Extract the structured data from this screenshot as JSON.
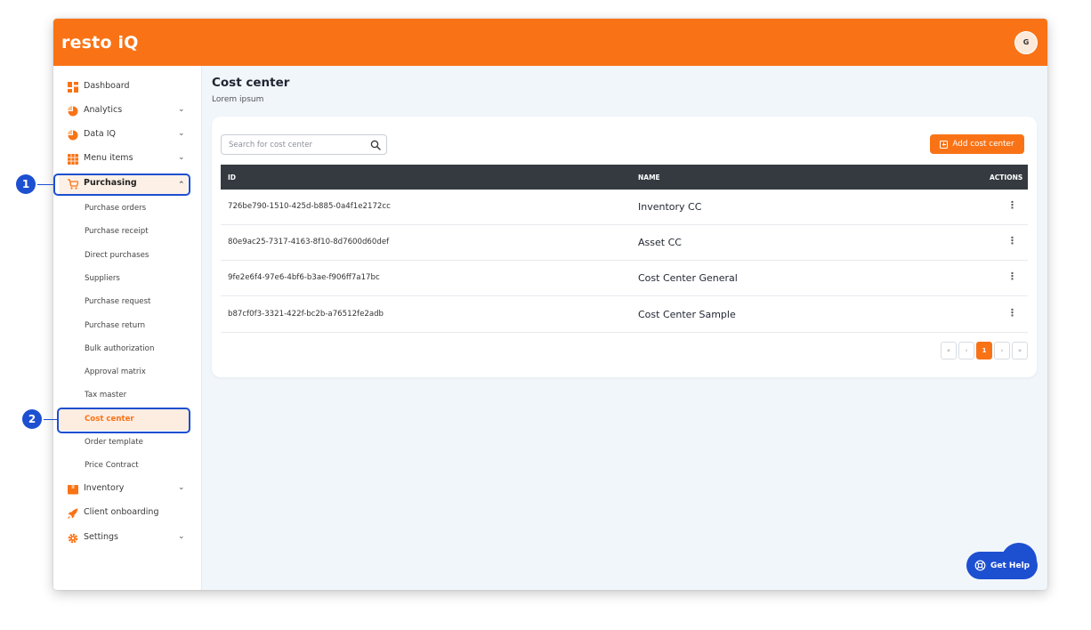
{
  "app": {
    "logo": "resto iQ",
    "avatar_initial": "G",
    "brand_color": "#f97316",
    "annotation_color": "#1d4fd1"
  },
  "sidebar": {
    "top_items": [
      {
        "label": "Dashboard",
        "icon": "dashboard-icon",
        "has_chevron": false
      },
      {
        "label": "Analytics",
        "icon": "analytics-icon",
        "has_chevron": true
      },
      {
        "label": "Data IQ",
        "icon": "data-iq-icon",
        "has_chevron": true
      },
      {
        "label": "Menu items",
        "icon": "menu-items-icon",
        "has_chevron": true
      },
      {
        "label": "Purchasing",
        "icon": "cart-icon",
        "has_chevron": true,
        "expanded": true
      }
    ],
    "purchasing_sub": [
      "Purchase orders",
      "Purchase receipt",
      "Direct purchases",
      "Suppliers",
      "Purchase request",
      "Purchase return",
      "Bulk authorization",
      "Approval matrix",
      "Tax master",
      "Cost center",
      "Order template",
      "Price Contract"
    ],
    "active_sub": "Cost center",
    "bottom_items": [
      {
        "label": "Inventory",
        "icon": "inventory-icon",
        "has_chevron": true
      },
      {
        "label": "Client onboarding",
        "icon": "rocket-icon",
        "has_chevron": false
      },
      {
        "label": "Settings",
        "icon": "gear-icon",
        "has_chevron": true
      }
    ]
  },
  "annotations": {
    "step1": "1",
    "step2": "2"
  },
  "main": {
    "title": "Cost center",
    "subtitle": "Lorem ipsum",
    "search_placeholder": "Search for cost center",
    "add_button": "Add cost center",
    "columns": {
      "id": "ID",
      "name": "NAME",
      "actions": "ACTIONS"
    },
    "rows": [
      {
        "id": "726be790-1510-425d-b885-0a4f1e2172cc",
        "name": "Inventory CC"
      },
      {
        "id": "80e9ac25-7317-4163-8f10-8d7600d60def",
        "name": "Asset CC"
      },
      {
        "id": "9fe2e6f4-97e6-4bf6-b3ae-f906ff7a17bc",
        "name": "Cost Center General"
      },
      {
        "id": "b87cf0f3-3321-422f-bc2b-a76512fe2adb",
        "name": "Cost Center Sample"
      }
    ],
    "pagination": {
      "first": "«",
      "prev": "‹",
      "current": "1",
      "next": "›",
      "last": "»"
    }
  },
  "help": {
    "label": "Get Help"
  }
}
